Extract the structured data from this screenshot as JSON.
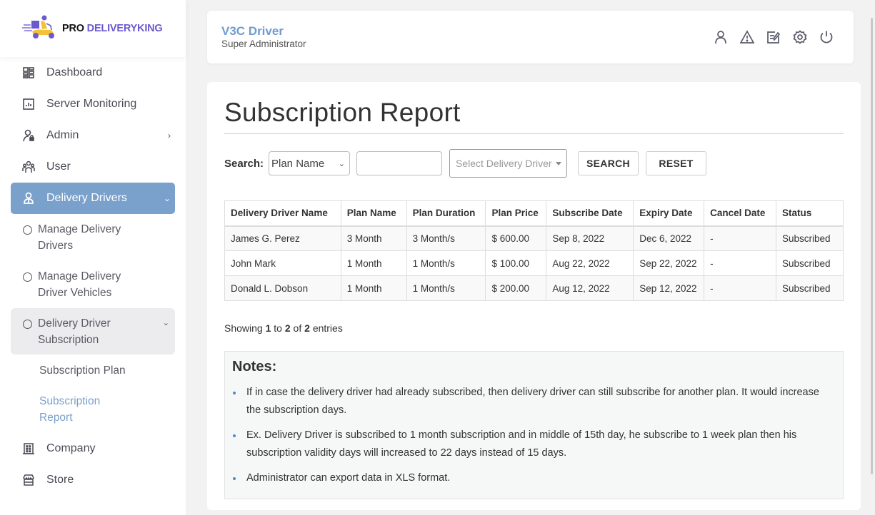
{
  "brand": {
    "logo_icon": "delivery-scooter-icon",
    "name_part1": "PRO",
    "name_part2": "DELIVERYKING",
    "accent_color": "#6a5acd"
  },
  "sidebar": {
    "active_color": "#7aa0cc",
    "items": [
      {
        "label": "Dashboard",
        "icon": "dashboard-icon"
      },
      {
        "label": "Server Monitoring",
        "icon": "chart-icon"
      },
      {
        "label": "Admin",
        "icon": "admin-lock-icon",
        "chevron": "›"
      },
      {
        "label": "User",
        "icon": "users-icon"
      },
      {
        "label": "Delivery Drivers",
        "icon": "driver-icon",
        "chevron": "⌄"
      },
      {
        "label": "Company",
        "icon": "building-icon"
      },
      {
        "label": "Store",
        "icon": "store-icon"
      }
    ],
    "sub_items": [
      {
        "label": "Manage Delivery Drivers"
      },
      {
        "label": "Manage Delivery Driver Vehicles"
      },
      {
        "label": "Delivery Driver Subscription",
        "chevron": "⌄"
      }
    ],
    "sub_sub_items": [
      {
        "label": "Subscription Plan"
      },
      {
        "label": "Subscription Report"
      }
    ]
  },
  "header": {
    "user_name": "V3C Driver",
    "user_role": "Super Administrator",
    "icons": [
      "user-icon",
      "warning-icon",
      "edit-icon",
      "settings-icon",
      "power-icon"
    ]
  },
  "main": {
    "title": "Subscription Report",
    "search": {
      "label": "Search:",
      "field_select_value": "Plan Name",
      "text_value": "",
      "driver_placeholder": "Select Delivery Driver",
      "search_button": "SEARCH",
      "reset_button": "RESET"
    },
    "table": {
      "columns": [
        "Delivery Driver Name",
        "Plan Name",
        "Plan Duration",
        "Plan Price",
        "Subscribe Date",
        "Expiry Date",
        "Cancel Date",
        "Status"
      ],
      "rows": [
        [
          "James G. Perez",
          "3 Month",
          "3 Month/s",
          "$ 600.00",
          "Sep 8, 2022",
          "Dec 6, 2022",
          "-",
          "Subscribed"
        ],
        [
          "John Mark",
          "1 Month",
          "1 Month/s",
          "$ 100.00",
          "Aug 22, 2022",
          "Sep 22, 2022",
          "-",
          "Subscribed"
        ],
        [
          "Donald L. Dobson",
          "1 Month",
          "1 Month/s",
          "$ 200.00",
          "Aug 12, 2022",
          "Sep 12, 2022",
          "-",
          "Subscribed"
        ]
      ]
    },
    "showing": {
      "prefix": "Showing",
      "from": "1",
      "to_word": "to",
      "to": "2",
      "of_word": "of",
      "total": "2",
      "suffix": "entries"
    },
    "notes": {
      "title": "Notes:",
      "items": [
        "If in case the delivery driver had already subscribed, then delivery driver can still subscribe for another plan. It would increase the subscription days.",
        "Ex. Delivery Driver is subscribed to 1 month subscription and in middle of 15th day, he subscribe to 1 week plan then his subscription validity days will increased to 22 days instead of 15 days.",
        "Administrator can export data in XLS format."
      ]
    }
  }
}
